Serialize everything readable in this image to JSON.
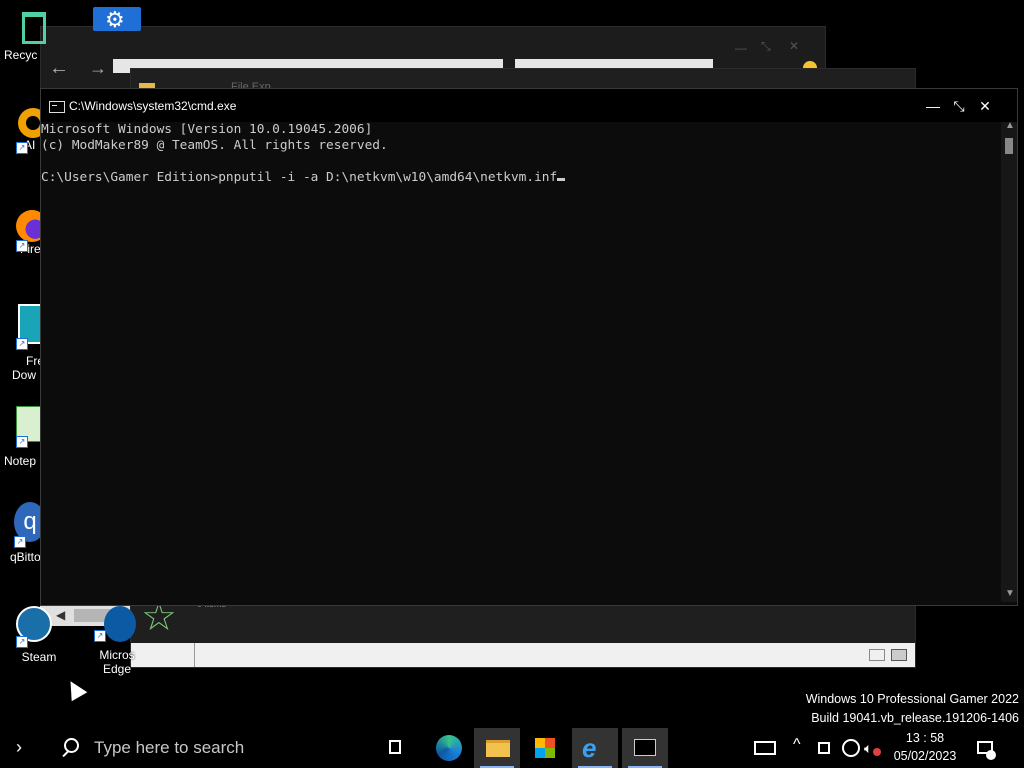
{
  "desktop": {
    "icons": [
      {
        "label": "Recyc"
      },
      {
        "label": "AI"
      },
      {
        "label": "Fire"
      },
      {
        "label": "Fre",
        "label2": "Dow"
      },
      {
        "label": "Notep"
      },
      {
        "label": "qBitto"
      },
      {
        "label": "Steam"
      },
      {
        "label": "Micros",
        "label2": "Edge"
      }
    ]
  },
  "background_window": {
    "title_fragment": "File Exp",
    "items_label": "0 items"
  },
  "cmd": {
    "title": "C:\\Windows\\system32\\cmd.exe",
    "lines": [
      "Microsoft Windows [Version 10.0.19045.2006]",
      "(c) ModMaker89 @ TeamOS. All rights reserved.",
      "",
      "C:\\Users\\Gamer Edition>pnputil -i -a D:\\netkvm\\w10\\amd64\\netkvm.inf"
    ],
    "minimize": "—",
    "maximize": "⤡",
    "close": "✕"
  },
  "watermark": {
    "line1": "Windows 10 Professional Gamer 2022",
    "line2": "Build 19041.vb_release.191206-1406"
  },
  "taskbar": {
    "search_placeholder": "Type here to search",
    "time": "13 : 58",
    "date": "05/02/2023",
    "accent": "#8ab4f8"
  }
}
